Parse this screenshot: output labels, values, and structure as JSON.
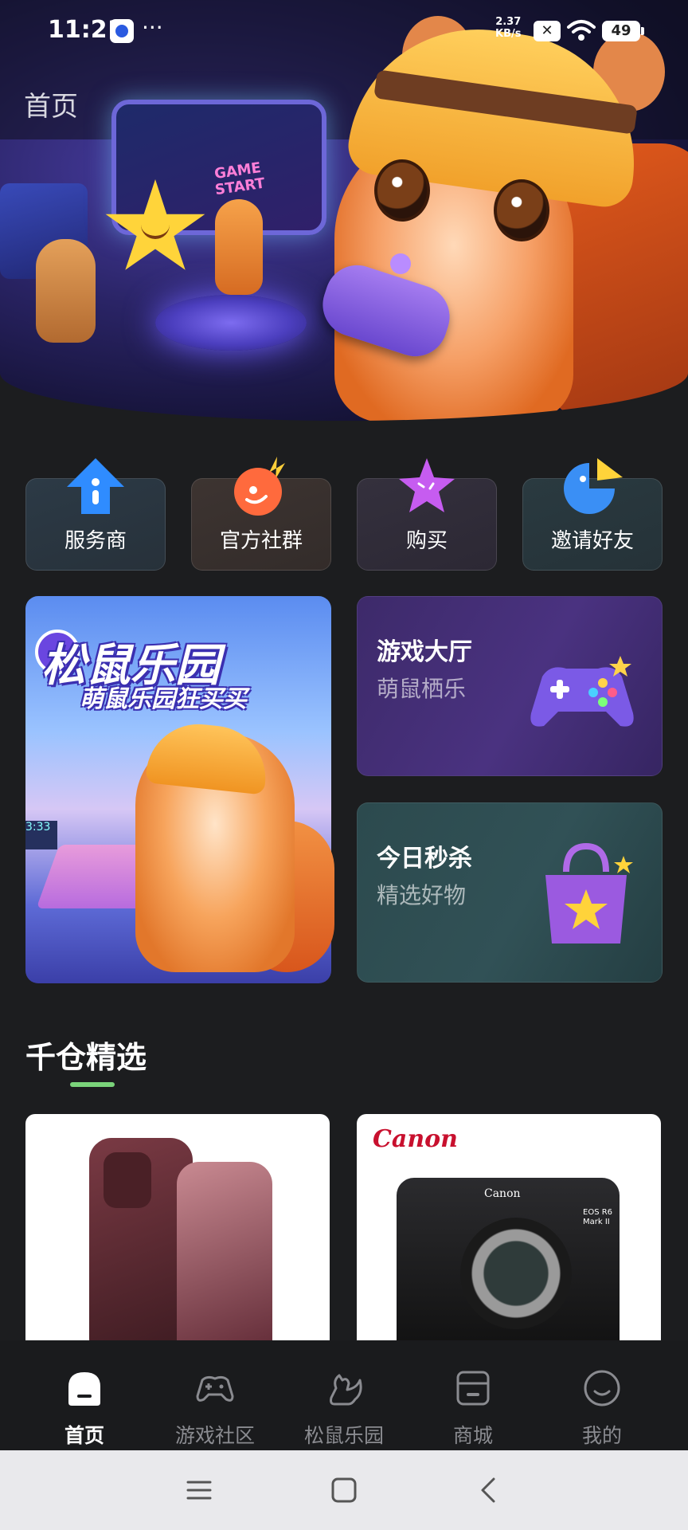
{
  "status_bar": {
    "time": "11:21",
    "more": "···",
    "net_speed_value": "2.37",
    "net_speed_unit": "KB/s",
    "sim_icon": "x-box-icon",
    "sim_label": "✕",
    "battery": "49"
  },
  "header": {
    "title": "首页"
  },
  "hero": {
    "screen_text": "GAME START"
  },
  "quick_entries": [
    {
      "label": "服务商",
      "icon": "arrow-up-icon"
    },
    {
      "label": "官方社群",
      "icon": "fire-ball-icon"
    },
    {
      "label": "购买",
      "icon": "star-icon"
    },
    {
      "label": "邀请好友",
      "icon": "pie-icon"
    }
  ],
  "banner": {
    "title": "松鼠乐园",
    "subtitle": "萌鼠乐园狂买买",
    "screen_time": "3:33"
  },
  "cards": {
    "game": {
      "title": "游戏大厅",
      "subtitle": "萌鼠栖乐"
    },
    "flash": {
      "title": "今日秒杀",
      "subtitle": "精选好物"
    }
  },
  "section": {
    "title": "千仓精选"
  },
  "products": [
    {
      "brand": ""
    },
    {
      "brand": "Canon",
      "camera_brand": "Canon",
      "camera_model": "EOS R6 Mark II"
    }
  ],
  "bottom_nav": [
    {
      "label": "首页",
      "icon": "home-icon",
      "active": true
    },
    {
      "label": "游戏社区",
      "icon": "gamepad-icon",
      "active": false
    },
    {
      "label": "松鼠乐园",
      "icon": "squirrel-icon",
      "active": false
    },
    {
      "label": "商城",
      "icon": "store-icon",
      "active": false
    },
    {
      "label": "我的",
      "icon": "smile-icon",
      "active": false
    }
  ],
  "colors": {
    "background": "#1c1d1f",
    "accent_green": "#7ad37a",
    "game_card": "#4a3280",
    "flash_card": "#315156"
  }
}
